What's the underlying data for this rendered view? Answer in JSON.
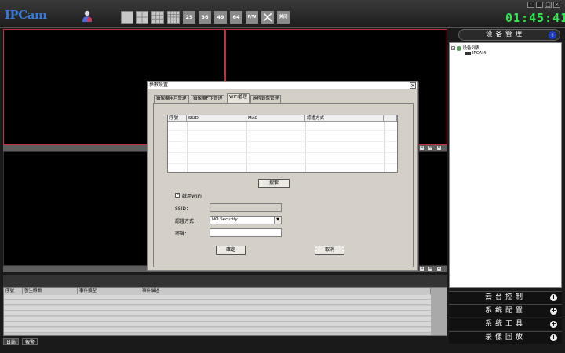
{
  "app": {
    "logo": "IPCam",
    "clock": "01:45:41"
  },
  "toolbar": {
    "layouts": [
      "1",
      "4",
      "9",
      "16",
      "25",
      "36",
      "49",
      "64"
    ],
    "full_label": "F/W",
    "close_label": "关闭"
  },
  "device_manager": {
    "title": "设备管理",
    "tree_root": "设备列表",
    "tree_child": "IPCAM"
  },
  "side_buttons": [
    {
      "label": "云台控制"
    },
    {
      "label": "系统配置"
    },
    {
      "label": "系统工具"
    },
    {
      "label": "录像回放"
    }
  ],
  "events": {
    "columns": [
      "序號",
      "發生時間",
      "事件類型",
      "事件描述"
    ],
    "tabs": [
      "日誌",
      "報警"
    ]
  },
  "dialog": {
    "title": "參數設置",
    "tabs": [
      "攝像機用戶管理",
      "攝像機FTP管理",
      "WIFI管理",
      "遠程錄像管理"
    ],
    "active_tab": "WIFI管理",
    "table_columns": [
      "序號",
      "SSID",
      "MAC",
      "認證方式"
    ],
    "search_button": "搜索",
    "enable_wifi_label": "啟用WIFI",
    "enable_wifi_checked": true,
    "ssid_label": "SSID：",
    "ssid_value": "",
    "auth_label": "認證方式：",
    "auth_value": "NO Security",
    "password_label": "密碼：",
    "password_value": "",
    "ok_button": "確定",
    "cancel_button": "取消"
  }
}
